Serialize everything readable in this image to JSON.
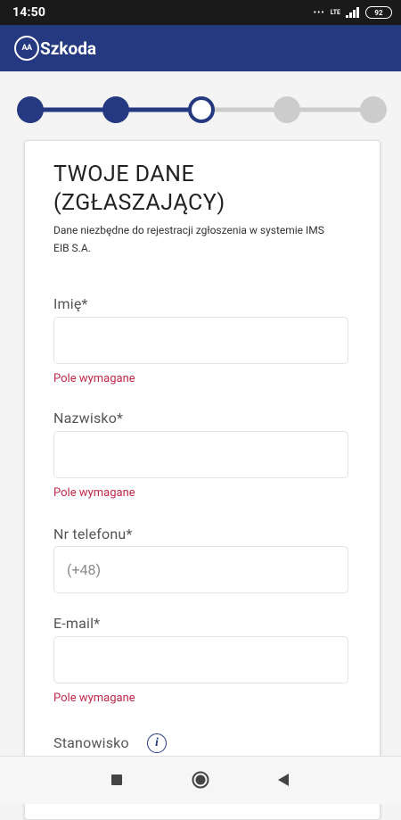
{
  "status_bar": {
    "time": "14:50",
    "dots": "•••",
    "network": "LTE",
    "battery": "92",
    "icons": [
      "signal-icon",
      "battery-icon"
    ]
  },
  "app_bar": {
    "logo_mark": "AA",
    "logo_text": "Szkoda",
    "color": "#253981"
  },
  "stepper": {
    "total_steps": 5,
    "current_step": 3,
    "active_color": "#253981",
    "inactive_color": "#cccccc"
  },
  "form": {
    "title": "TWOJE DANE (ZGŁASZAJĄCY)",
    "subtitle": "Dane niezbędne do rejestracji zgłoszenia w systemie IMS EIB S.A.",
    "fields": [
      {
        "label": "Imię*",
        "value": "",
        "placeholder": "",
        "error": "Pole wymagane"
      },
      {
        "label": "Nazwisko*",
        "value": "",
        "placeholder": "",
        "error": "Pole wymagane"
      },
      {
        "label": "Nr telefonu*",
        "value": "",
        "placeholder": "(+48)",
        "error": ""
      },
      {
        "label": "E-mail*",
        "value": "",
        "placeholder": "",
        "error": "Pole wymagane"
      },
      {
        "label": "Stanowisko",
        "info_icon": "info-icon"
      }
    ],
    "error_color": "#c0294b"
  },
  "nav_bar": {
    "buttons": [
      "recents-icon",
      "home-icon",
      "back-icon"
    ]
  }
}
